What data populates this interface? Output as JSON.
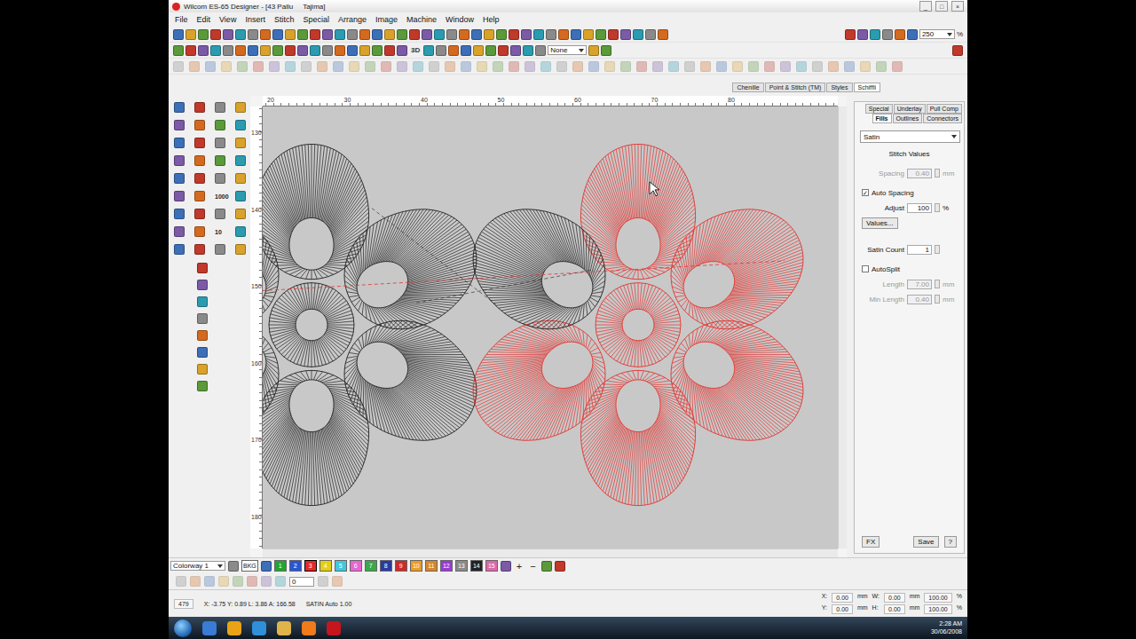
{
  "window": {
    "title": "Wilcom ES-65 Designer - [43 Pallu     Tajima]",
    "controls": [
      "_",
      "□",
      "×"
    ]
  },
  "menu": [
    "File",
    "Edit",
    "View",
    "Insert",
    "Stitch",
    "Special",
    "Arrange",
    "Image",
    "Machine",
    "Window",
    "Help"
  ],
  "toolbar": {
    "zoom": "250",
    "zoom_unit": "%",
    "thread_dropdown": "None",
    "view_3d": "3D"
  },
  "docker_tabs": [
    {
      "label": "Chenille",
      "selected": false
    },
    {
      "label": "Point & Stitch (TM)",
      "selected": false
    },
    {
      "label": "Styles",
      "selected": false
    },
    {
      "label": "Schiffli",
      "selected": true
    }
  ],
  "toolbox": {
    "texts": [
      "1000",
      "10"
    ]
  },
  "rulers": {
    "top": [
      "20",
      "30",
      "40",
      "50",
      "60",
      "70",
      "80"
    ],
    "left": [
      "130",
      "140",
      "150",
      "160",
      "170",
      "180"
    ]
  },
  "designs": [
    {
      "selected": false,
      "ring_color": "#1e1e1e",
      "petals": [
        {
          "color": "#1e1e1e"
        },
        {
          "color": "#1e1e1e"
        },
        {
          "color": "#1e1e1e"
        },
        {
          "color": "#1e1e1e"
        },
        {
          "color": "#1e1e1e"
        },
        {
          "color": "#1e1e1e"
        }
      ]
    },
    {
      "selected": true,
      "ring_color": "#e3312d",
      "petals": [
        {
          "color": "#e3312d"
        },
        {
          "color": "#e3312d"
        },
        {
          "color": "#e3312d"
        },
        {
          "color": "#e3312d"
        },
        {
          "color": "#e3312d"
        },
        {
          "color": "#1e1e1e"
        }
      ]
    }
  ],
  "properties": {
    "tabs": [
      {
        "label": "Special",
        "selected": false
      },
      {
        "label": "Underlay",
        "selected": false
      },
      {
        "label": "Pull Comp",
        "selected": false
      },
      {
        "label": "Fills",
        "selected": true
      },
      {
        "label": "Outlines",
        "selected": false
      },
      {
        "label": "Connectors",
        "selected": false
      }
    ],
    "fill_type": "Satin",
    "section": "Stitch Values",
    "fields": [
      {
        "kind": "input",
        "label": "Spacing",
        "value": "0.40",
        "unit": "mm",
        "disabled": true
      },
      {
        "kind": "checkbox",
        "label": "Auto Spacing",
        "checked": true
      },
      {
        "kind": "input",
        "label": "Adjust",
        "value": "100",
        "unit": "%",
        "disabled": false
      },
      {
        "kind": "button",
        "label": "Values..."
      },
      {
        "kind": "input",
        "label": "Satin Count",
        "value": "1",
        "unit": "",
        "disabled": false
      },
      {
        "kind": "checkbox",
        "label": "AutoSplit",
        "checked": false
      },
      {
        "kind": "input",
        "label": "Length",
        "value": "7.00",
        "unit": "mm",
        "disabled": true
      },
      {
        "kind": "input",
        "label": "Min Length",
        "value": "0.40",
        "unit": "mm",
        "disabled": true
      }
    ],
    "buttons": [
      "FX",
      "Save",
      "?"
    ]
  },
  "colorbar": {
    "colorway": "Colorway 1",
    "background": "BKG",
    "actions": [
      "+",
      "−"
    ],
    "swatches": [
      {
        "label": "1",
        "color": "#22a532",
        "selected": false
      },
      {
        "label": "2",
        "color": "#2a55d0",
        "selected": false
      },
      {
        "label": "3",
        "color": "#e02a2a",
        "selected": true
      },
      {
        "label": "4",
        "color": "#e6cf10",
        "selected": false
      },
      {
        "label": "5",
        "color": "#3fc7e0",
        "selected": false
      },
      {
        "label": "6",
        "color": "#e866d0",
        "selected": false
      },
      {
        "label": "7",
        "color": "#3aa84a",
        "selected": false
      },
      {
        "label": "8",
        "color": "#2a3aa0",
        "selected": false
      },
      {
        "label": "9",
        "color": "#cc2a2a",
        "selected": false
      },
      {
        "label": "10",
        "color": "#ee9a22",
        "selected": false
      },
      {
        "label": "11",
        "color": "#d8862a",
        "selected": false
      },
      {
        "label": "12",
        "color": "#9a3ad0",
        "selected": false
      },
      {
        "label": "13",
        "color": "#8a8a8a",
        "selected": false
      },
      {
        "label": "14",
        "color": "#222222",
        "selected": false
      },
      {
        "label": "15",
        "color": "#dd66aa",
        "selected": false
      }
    ]
  },
  "sequence_counter": "0",
  "status": {
    "count": "479",
    "coords": "X: -3.75 Y: 0.89 L: 3.86 A: 166.58",
    "mode": "SATIN Auto 1.00",
    "position": [
      {
        "axis": "X:",
        "value": "0.00",
        "unit": "mm",
        "size_axis": "W:",
        "size": "0.00",
        "size_unit": "mm",
        "scale": "100.00",
        "scale_unit": "%"
      },
      {
        "axis": "Y:",
        "value": "0.00",
        "unit": "mm",
        "size_axis": "H:",
        "size": "0.00",
        "size_unit": "mm",
        "scale": "100.00",
        "scale_unit": "%"
      }
    ]
  },
  "taskbar": {
    "time": "2:28 AM",
    "date": "30/06/2008"
  }
}
